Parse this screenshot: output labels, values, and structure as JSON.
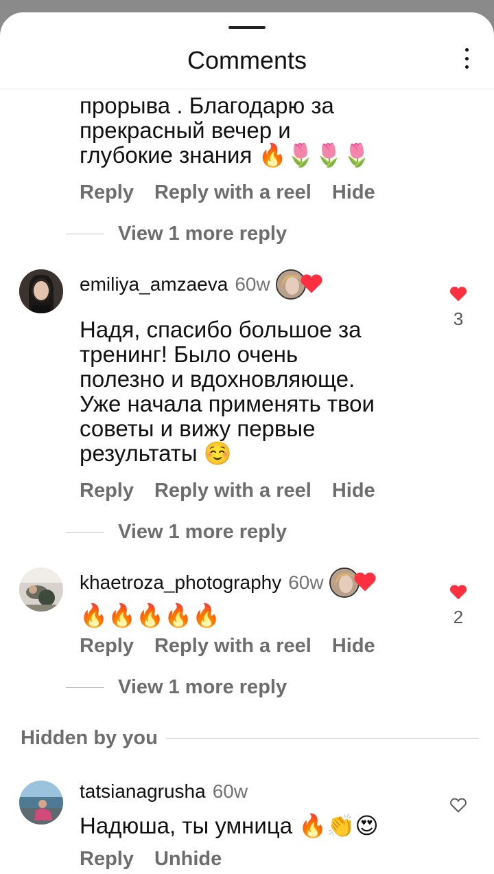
{
  "header": {
    "title": "Comments"
  },
  "top_comment": {
    "lines": [
      "прорыва . Благодарю за",
      "прекрасный вечер и",
      "глубокие знания 🔥🌷🌷🌷"
    ],
    "actions": [
      "Reply",
      "Reply with a reel",
      "Hide"
    ],
    "view_more": "View 1 more reply"
  },
  "comments": [
    {
      "username": "emiliya_amzaeva",
      "age": "60w",
      "lines": [
        "Надя, спасибо большое за",
        "тренинг! Было очень",
        "полезно и вдохновляюще.",
        "Уже начала применять твои",
        "советы и вижу первые",
        "результаты ☺️"
      ],
      "likes": "3",
      "liked_state": "liked",
      "actions": [
        "Reply",
        "Reply with a reel",
        "Hide"
      ],
      "view_more": "View 1 more reply"
    },
    {
      "username": "khaetroza_photography",
      "age": "60w",
      "lines": [
        "🔥🔥🔥🔥🔥"
      ],
      "likes": "2",
      "liked_state": "liked",
      "actions": [
        "Reply",
        "Reply with a reel",
        "Hide"
      ],
      "view_more": "View 1 more reply"
    }
  ],
  "hidden_section": {
    "label": "Hidden by you",
    "comment": {
      "username": "tatsianagrusha",
      "age": "60w",
      "text": "Надюша, ты умница 🔥👏😍",
      "actions": [
        "Reply",
        "Unhide"
      ],
      "liked_state": "not-liked"
    }
  },
  "colors": {
    "heart": "#ff3040",
    "secondary_text": "#6d6d6d"
  }
}
